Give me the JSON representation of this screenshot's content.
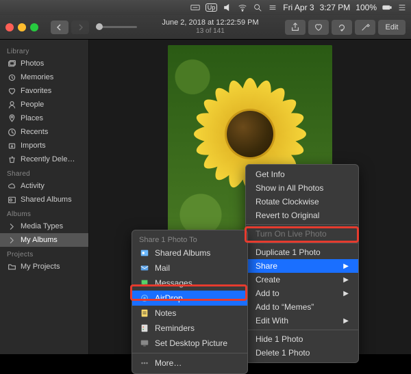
{
  "menubar": {
    "up": "Up",
    "date": "Fri Apr 3",
    "time": "3:27 PM",
    "battery": "100%"
  },
  "toolbar": {
    "title": "June 2, 2018 at 12:22:59 PM",
    "counter": "13 of 141",
    "edit": "Edit"
  },
  "sidebar": {
    "library_h": "Library",
    "library": [
      {
        "label": "Photos",
        "icon": "photo-stack-icon"
      },
      {
        "label": "Memories",
        "icon": "memories-icon"
      },
      {
        "label": "Favorites",
        "icon": "heart-icon"
      },
      {
        "label": "People",
        "icon": "person-icon"
      },
      {
        "label": "Places",
        "icon": "pin-icon"
      },
      {
        "label": "Recents",
        "icon": "clock-icon"
      },
      {
        "label": "Imports",
        "icon": "import-icon"
      },
      {
        "label": "Recently Dele…",
        "icon": "trash-icon"
      }
    ],
    "shared_h": "Shared",
    "shared": [
      {
        "label": "Activity",
        "icon": "cloud-icon"
      },
      {
        "label": "Shared Albums",
        "icon": "shared-album-icon"
      }
    ],
    "albums_h": "Albums",
    "albums": [
      {
        "label": "Media Types",
        "icon": "chevron-icon"
      },
      {
        "label": "My Albums",
        "icon": "chevron-icon",
        "selected": true
      }
    ],
    "projects_h": "Projects",
    "projects": [
      {
        "label": "My Projects",
        "icon": "folder-icon"
      }
    ]
  },
  "context": {
    "items": [
      {
        "label": "Get Info"
      },
      {
        "label": "Show in All Photos"
      },
      {
        "label": "Rotate Clockwise"
      },
      {
        "label": "Revert to Original"
      },
      {
        "sep": true
      },
      {
        "label": "Turn On Live Photo",
        "disabled": true
      },
      {
        "sep": true
      },
      {
        "label": "Duplicate 1 Photo"
      },
      {
        "label": "Share",
        "sub": true,
        "selected": true
      },
      {
        "label": "Create",
        "sub": true
      },
      {
        "label": "Add to",
        "sub": true
      },
      {
        "label": "Add to “Memes”"
      },
      {
        "label": "Edit With",
        "sub": true
      },
      {
        "sep": true
      },
      {
        "label": "Hide 1 Photo"
      },
      {
        "label": "Delete 1 Photo"
      }
    ]
  },
  "share": {
    "header": "Share 1 Photo To",
    "items": [
      {
        "label": "Shared Albums",
        "icon": "shared-album-icon",
        "color": "#6bb8ff"
      },
      {
        "label": "Mail",
        "icon": "mail-icon",
        "color": "#5aa0e6"
      },
      {
        "label": "Messages",
        "icon": "messages-icon",
        "color": "#57d26a"
      },
      {
        "label": "AirDrop",
        "icon": "airdrop-icon",
        "color": "#6bb8ff",
        "selected": true
      },
      {
        "label": "Notes",
        "icon": "notes-icon",
        "color": "#f5d56a"
      },
      {
        "label": "Reminders",
        "icon": "reminders-icon",
        "color": "#ddd"
      },
      {
        "label": "Set Desktop Picture",
        "icon": "desktop-icon",
        "color": "#888"
      },
      {
        "sep": true
      },
      {
        "label": "More…",
        "icon": "more-icon",
        "color": "#888"
      }
    ]
  }
}
